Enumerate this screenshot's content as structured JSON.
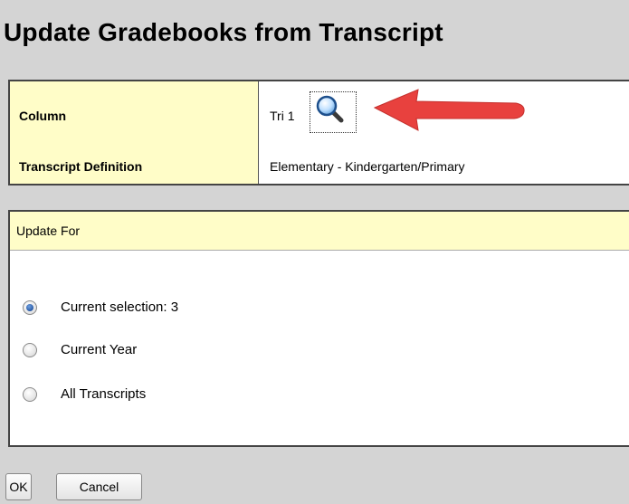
{
  "page": {
    "title": "Update Gradebooks from Transcript"
  },
  "fields": {
    "column_label": "Column",
    "column_value": "Tri 1",
    "transcript_definition_label": "Transcript Definition",
    "transcript_definition_value": "Elementary - Kindergarten/Primary",
    "lookup_icon": "magnifier-icon",
    "annotation": "red-arrow-pointing-left"
  },
  "update_for": {
    "header": "Update For",
    "options": [
      {
        "label": "Current selection: 3",
        "checked": true
      },
      {
        "label": "Current Year",
        "checked": false
      },
      {
        "label": "All Transcripts",
        "checked": false
      }
    ]
  },
  "buttons": {
    "ok": "OK",
    "cancel": "Cancel"
  },
  "colors": {
    "label_bg": "#fffdc8",
    "page_bg": "#d4d4d4",
    "arrow": "#e8413e"
  }
}
